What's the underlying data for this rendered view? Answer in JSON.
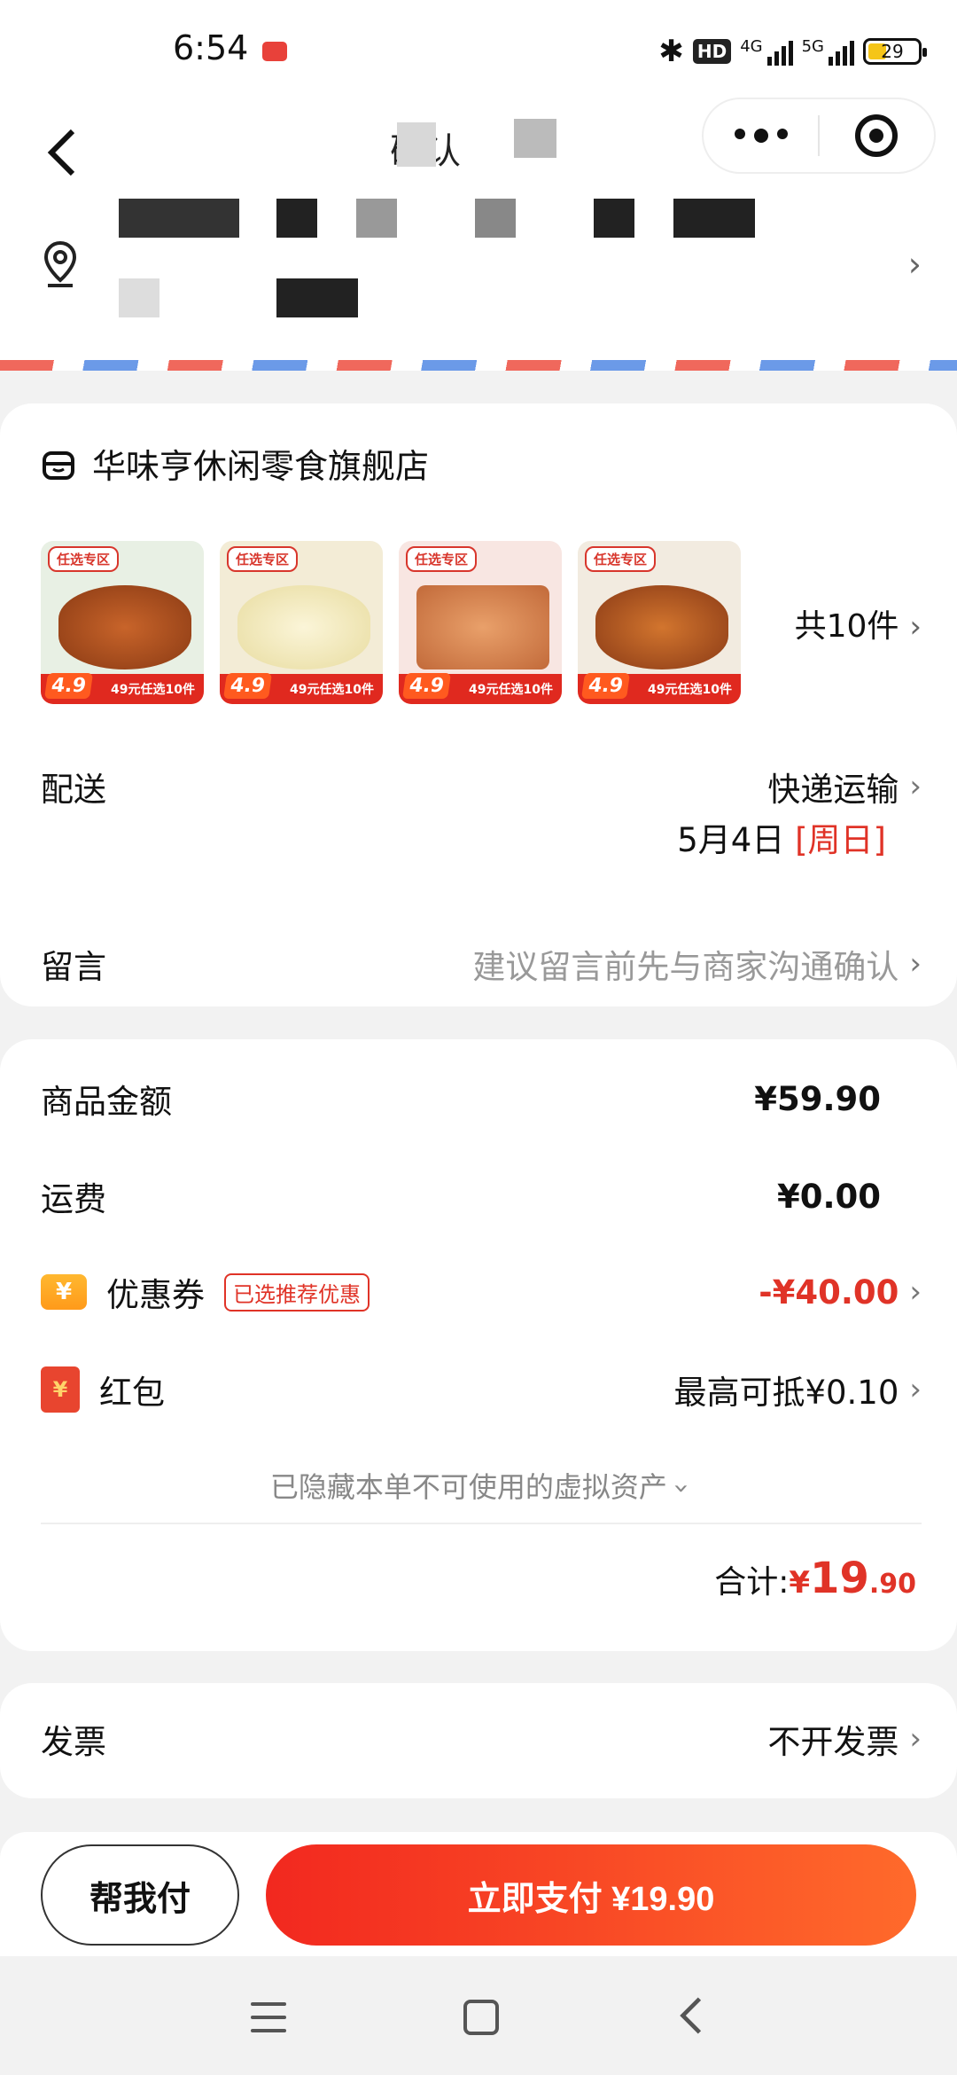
{
  "status_bar": {
    "time": "6:54",
    "app_badge": "🛍",
    "hd": "HD",
    "net1": "4G",
    "net2": "5G",
    "battery": "29"
  },
  "nav": {
    "title": "确认"
  },
  "store": {
    "name": "华味亨休闲零食旗舰店",
    "count": "共10件",
    "thumbs": [
      {
        "badge": "任选专区",
        "price_tag": "49元任选10件",
        "big": "4.9"
      },
      {
        "badge": "任选专区",
        "price_tag": "49元任选10件",
        "big": "4.9"
      },
      {
        "badge": "任选专区",
        "price_tag": "49元任选10件",
        "big": "4.9"
      },
      {
        "badge": "任选专区",
        "price_tag": "49元任选10件",
        "big": "4.9"
      }
    ]
  },
  "delivery": {
    "label": "配送",
    "method": "快递运输",
    "date": "5月4日",
    "weekday": "[周日]"
  },
  "message": {
    "label": "留言",
    "placeholder": "建议留言前先与商家沟通确认"
  },
  "fees": {
    "goods_label": "商品金额",
    "goods_value": "¥59.90",
    "shipping_label": "运费",
    "shipping_value": "¥0.00",
    "coupon_label": "优惠券",
    "coupon_tag": "已选推荐优惠",
    "coupon_value": "-¥40.00",
    "hongbao_label": "红包",
    "hongbao_value": "最高可抵¥0.10",
    "hidden_assets": "已隐藏本单不可使用的虚拟资产",
    "total_label": "合计:",
    "total_yen": "¥",
    "total_int": "19",
    "total_dec": ".90"
  },
  "invoice": {
    "label": "发票",
    "value": "不开发票"
  },
  "actions": {
    "help_pay": "帮我付",
    "pay_now": "立即支付 ¥19.90"
  },
  "icons": {
    "chevron": "›",
    "yen": "¥"
  }
}
